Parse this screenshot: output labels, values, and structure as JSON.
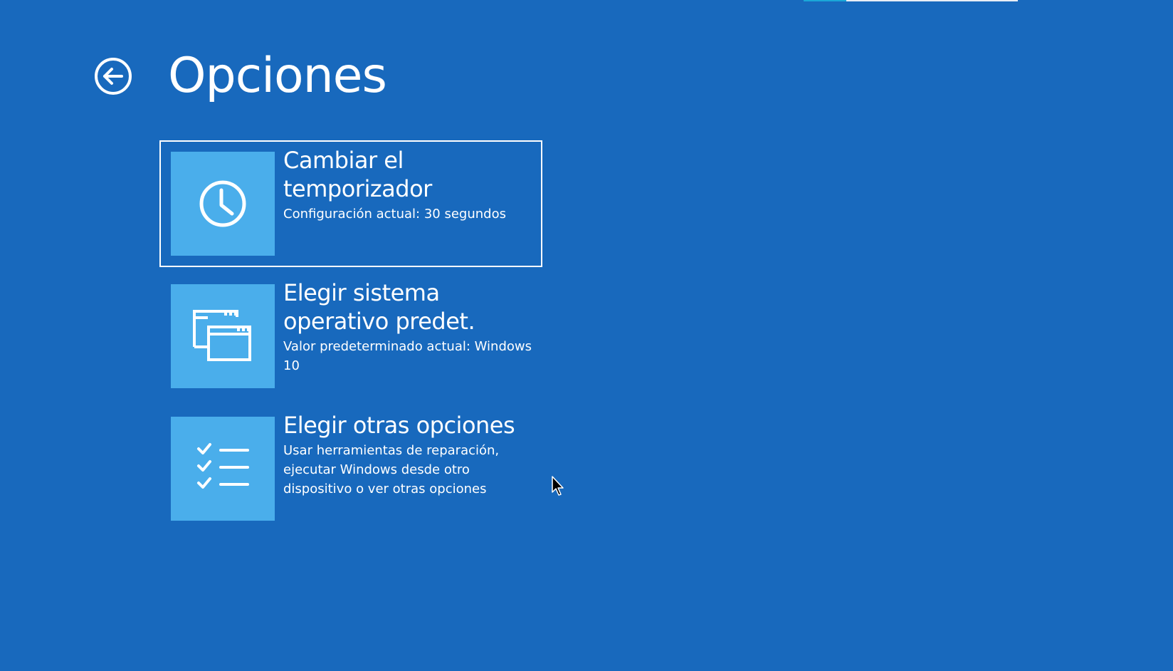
{
  "page": {
    "title": "Opciones",
    "background_color": "#1869bd",
    "tile_color": "#4aaeeb"
  },
  "back_button": {
    "icon": "back-arrow-circle-icon"
  },
  "options": [
    {
      "title": "Cambiar el temporizador",
      "description": "Configuración actual: 30 segundos",
      "icon": "clock-icon",
      "selected": true
    },
    {
      "title": "Elegir sistema operativo predet.",
      "description": "Valor predeterminado actual: Windows 10",
      "icon": "windows-stack-icon",
      "selected": false
    },
    {
      "title": "Elegir otras opciones",
      "description": "Usar herramientas de reparación, ejecutar Windows desde otro dispositivo o ver otras opciones",
      "icon": "checklist-icon",
      "selected": false
    }
  ]
}
